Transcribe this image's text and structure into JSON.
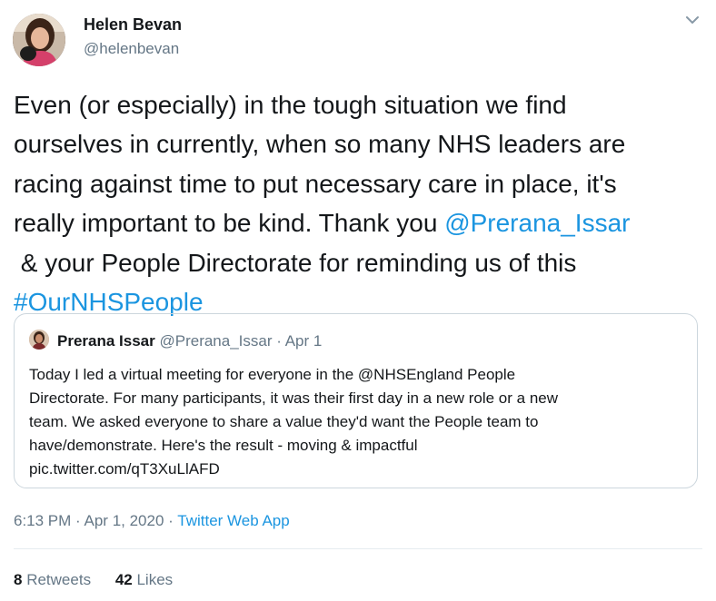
{
  "author": {
    "name": "Helen Bevan",
    "handle": "@helenbevan"
  },
  "tweet": {
    "lines": [
      [
        {
          "t": "Even (or especially) in the tough situation we find"
        }
      ],
      [
        {
          "t": "ourselves in currently, when so many NHS leaders are"
        }
      ],
      [
        {
          "t": "racing against time to put necessary care in place, it's"
        }
      ],
      [
        {
          "t": "really important to be kind. Thank you "
        },
        {
          "t": "@Prerana_Issar",
          "link": true
        }
      ],
      [
        {
          "t": " & your People Directorate for reminding us of this"
        }
      ],
      [
        {
          "t": "#OurNHSPeople",
          "link": true
        }
      ]
    ]
  },
  "quote": {
    "name": "Prerana Issar",
    "handle": "@Prerana_Issar",
    "date": "Apr 1",
    "sep": "·",
    "lines": [
      "Today I led a virtual meeting for everyone in the @NHSEngland People",
      "Directorate. For many participants, it was their first day in a new role or a new",
      "team. We asked everyone to share a value they'd want the People team to",
      "have/demonstrate. Here's the result - moving & impactful",
      "pic.twitter.com/qT3XuLlAFD"
    ]
  },
  "meta": {
    "time": "6:13 PM",
    "date": "Apr 1, 2020",
    "sep": "·",
    "app": "Twitter Web App"
  },
  "stats": {
    "retweets_count": "8",
    "retweets_label": "Retweets",
    "likes_count": "42",
    "likes_label": "Likes"
  },
  "colors": {
    "link": "#1b95e0",
    "muted": "#657786",
    "text": "#14171a"
  },
  "icons": {
    "caret": "chevron-down-icon"
  }
}
